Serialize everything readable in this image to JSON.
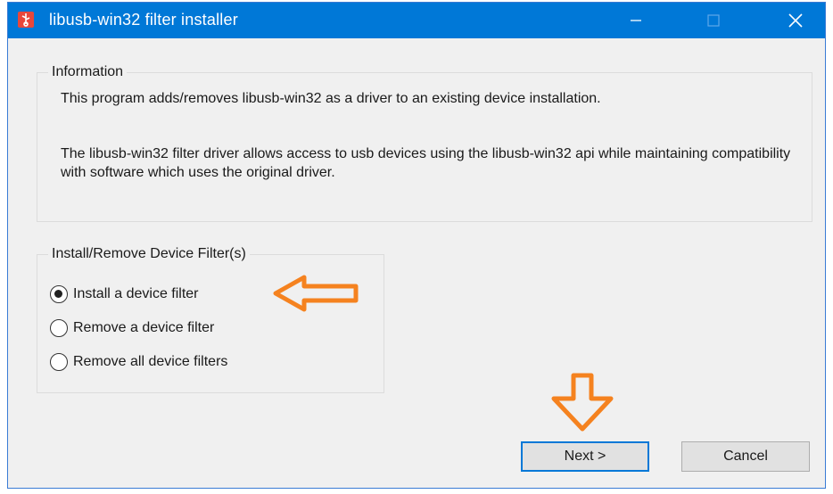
{
  "window": {
    "title": "libusb-win32 filter installer",
    "accent_color": "#0078d7",
    "controls": {
      "minimize_icon": "minimize-icon",
      "maximize_icon": "maximize-icon",
      "close_icon": "close-icon"
    }
  },
  "information": {
    "label": "Information",
    "paragraph1": "This program adds/removes libusb-win32 as a driver to an existing device installation.",
    "paragraph2": "The libusb-win32 filter driver allows access to usb devices using the libusb-win32 api while maintaining compatibility with software which uses the original driver."
  },
  "filter_group": {
    "label": "Install/Remove Device Filter(s)",
    "options": [
      {
        "label": "Install a device filter",
        "checked": true
      },
      {
        "label": "Remove a device filter",
        "checked": false
      },
      {
        "label": "Remove all device filters",
        "checked": false
      }
    ]
  },
  "buttons": {
    "next": "Next >",
    "cancel": "Cancel"
  },
  "annotations": {
    "arrow_color": "#f5821f"
  }
}
